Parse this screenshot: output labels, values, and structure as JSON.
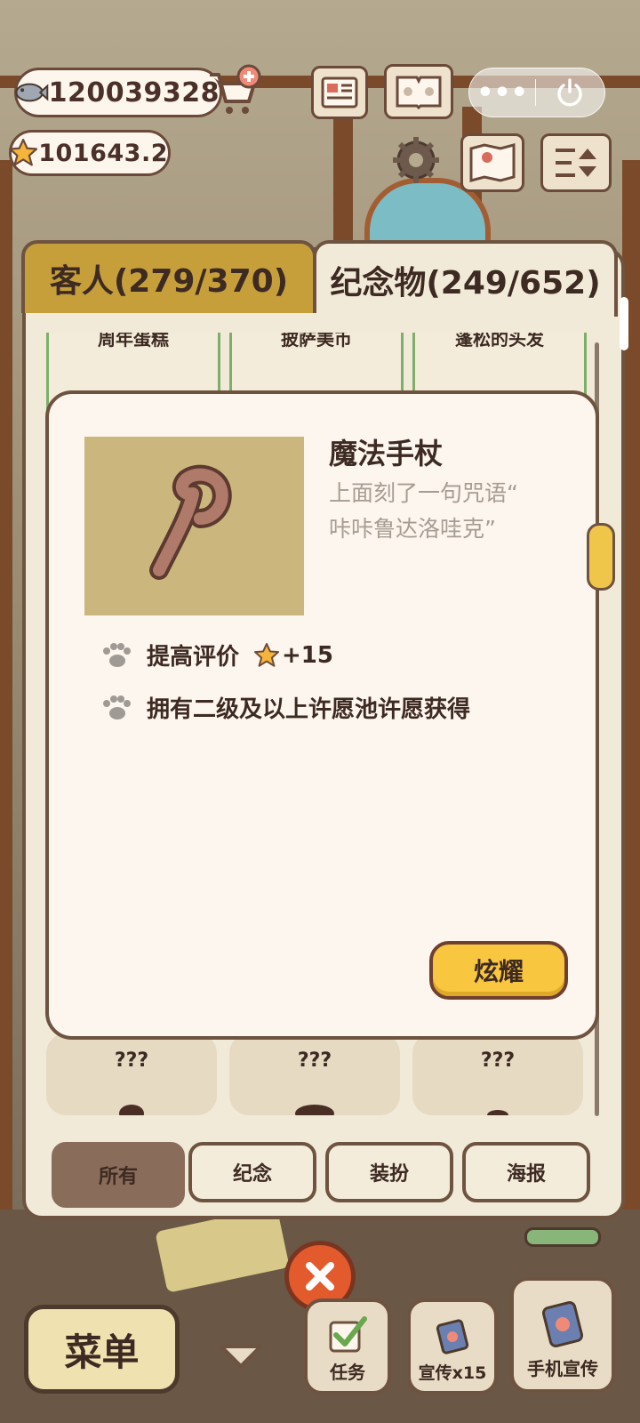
{
  "currency": {
    "fish": "120039328",
    "stars": "101643.2"
  },
  "tabs": [
    {
      "label": "客人(279/370)"
    },
    {
      "label": "纪念物(249/652)"
    }
  ],
  "grid_partial_titles": [
    "周年蛋糕",
    "披萨美币",
    "蓬松的头发"
  ],
  "locked_cards": [
    {
      "label": "???"
    },
    {
      "label": "???"
    },
    {
      "label": "???"
    }
  ],
  "filters": [
    {
      "label": "所有",
      "active": true
    },
    {
      "label": "纪念"
    },
    {
      "label": "装扮"
    },
    {
      "label": "海报"
    }
  ],
  "detail": {
    "title": "魔法手杖",
    "description_line1": "上面刻了一句咒语“",
    "description_line2": "咔咔鲁达洛哇克”",
    "effects": [
      {
        "text": "提高评价",
        "bonus": "+15"
      },
      {
        "text": "拥有二级及以上许愿池许愿获得"
      }
    ],
    "show_button": "炫耀"
  },
  "bottom_bar": {
    "menu": "菜单",
    "tasks": "任务",
    "promo": "宣传x15",
    "phone_promo": "手机宣传"
  },
  "colors": {
    "panel_border": "#6e5440",
    "button_yellow": "#f9c63f",
    "close_red": "#e35a2d",
    "card_green": "#7fae6a"
  }
}
